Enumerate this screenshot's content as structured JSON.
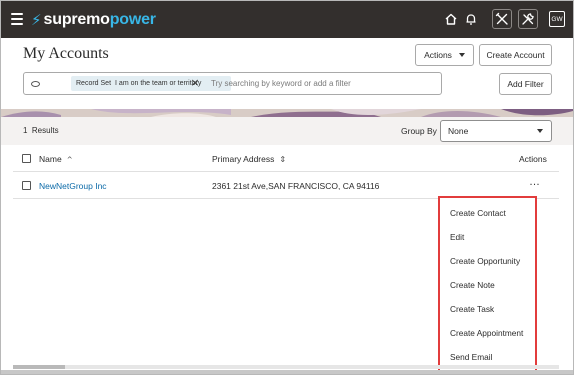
{
  "app": {
    "logo_bolt": "⚡",
    "logo_part1": "supremo",
    "logo_part2": "power",
    "avatar_initials": "GW",
    "brand_color": "#38b6e6",
    "topbar_color": "#332f2d"
  },
  "header": {
    "title": "My Accounts",
    "actions_label": "Actions",
    "create_label": "Create Account",
    "add_filter_label": "Add Filter"
  },
  "search": {
    "chip_label": "Record Set",
    "chip_value": "I am on the team or territory",
    "placeholder": "Try searching by keyword or add a filter"
  },
  "results": {
    "count": "1",
    "count_label": "Results",
    "group_by_label": "Group By",
    "group_by_value": "None"
  },
  "table": {
    "columns": [
      "Name",
      "Primary Address",
      "Actions"
    ],
    "rows": [
      {
        "name": "NewNetGroup Inc",
        "address": "2361 21st Ave,SAN FRANCISCO, CA 94116",
        "actions": "…"
      }
    ]
  },
  "menu": {
    "items": [
      "Create Contact",
      "Edit",
      "Create Opportunity",
      "Create Note",
      "Create Task",
      "Create Appointment",
      "Send Email"
    ],
    "highlight_color": "#e23c3c"
  }
}
